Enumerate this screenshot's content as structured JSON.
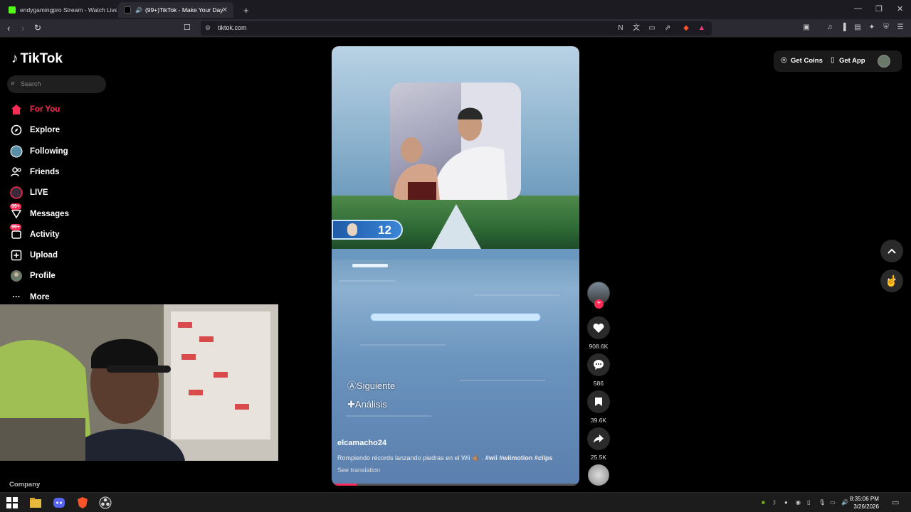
{
  "browser": {
    "tabs": [
      {
        "label": "endygamingpro Stream - Watch Live",
        "favicon_color": "#53fc18"
      },
      {
        "label": "(99+)TikTok - Make Your Day",
        "favicon_color": "#000000"
      }
    ],
    "new_tab_label": "+",
    "url": "tiktok.com"
  },
  "sidebar": {
    "logo": "TikTok",
    "search_placeholder": "Search",
    "items": [
      {
        "label": "For You",
        "icon": "home-icon",
        "active": true
      },
      {
        "label": "Explore",
        "icon": "compass-icon"
      },
      {
        "label": "Following",
        "icon": "following-avatar-icon"
      },
      {
        "label": "Friends",
        "icon": "friends-icon"
      },
      {
        "label": "LIVE",
        "icon": "live-icon"
      },
      {
        "label": "Messages",
        "icon": "messages-icon",
        "badge": "99+"
      },
      {
        "label": "Activity",
        "icon": "activity-icon",
        "badge": "99+"
      },
      {
        "label": "Upload",
        "icon": "upload-icon"
      },
      {
        "label": "Profile",
        "icon": "profile-avatar-icon"
      },
      {
        "label": "More",
        "icon": "more-icon"
      }
    ],
    "footer_label": "Company"
  },
  "video": {
    "score": "12",
    "overlay_next": "Siguiente",
    "overlay_analysis": "Análisis",
    "author": "elcamacho24",
    "description": "Rompiendo récords lanzando piedras en el Wii 🤙🏽 .",
    "hashtags": "#wii #wiimotion #clips",
    "see_translation": "See translation",
    "progress_fraction": 0.1
  },
  "actions": {
    "likes": "908.6K",
    "comments": "586",
    "saves": "39.6K",
    "shares": "25.5K"
  },
  "topbar": {
    "get_coins": "Get Coins",
    "get_app": "Get App"
  },
  "taskbar": {
    "time": "8:35:06 PM",
    "date": "3/26/2026"
  },
  "colors": {
    "accent": "#fe2c55",
    "background": "#000000"
  }
}
